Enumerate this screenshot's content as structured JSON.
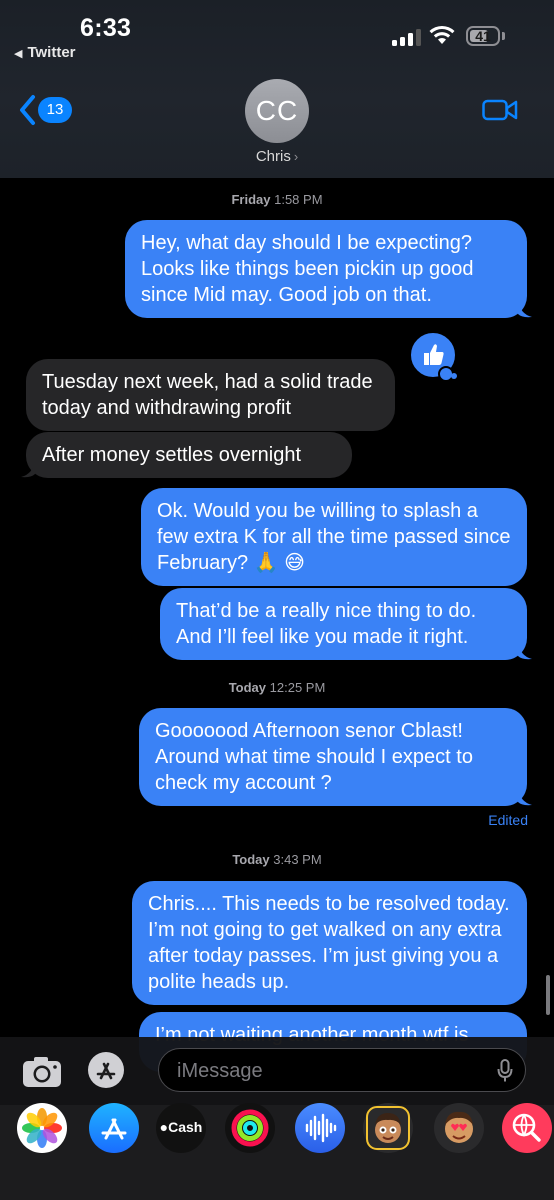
{
  "status_bar": {
    "time": "6:33",
    "back_app": "Twitter",
    "battery": "41"
  },
  "header": {
    "back_badge": "13",
    "avatar_initials": "CC",
    "contact_name": "Chris"
  },
  "messages": {
    "ts1": {
      "day": "Friday",
      "time": "1:58 PM"
    },
    "m1": "Hey, what day should I be expecting? Looks like things been pickin up good since Mid may. Good job on that.",
    "m2": "Tuesday next week, had a solid trade today and withdrawing profit",
    "m3": "After money settles overnight",
    "m4": "Ok. Would you be willing to splash a few extra K for all the time passed since February? 🙏 😅",
    "m5": "That’d be a really nice thing to do. And I’ll feel like you made it right.",
    "ts2": {
      "day": "Today",
      "time": "12:25 PM"
    },
    "m6": "Gooooood Afternoon senor Cblast! Around what time should I expect to check my account ?",
    "edited": "Edited",
    "ts3": {
      "day": "Today",
      "time": "3:43 PM"
    },
    "m7": "Chris.... This needs to be resolved today. I’m not going to get walked on any extra after today passes. I’m just giving you a polite heads up.",
    "m8": "I’m not waiting another month wtf is"
  },
  "input": {
    "placeholder": "iMessage"
  },
  "app_tray": {
    "cash_label": "Cash"
  },
  "colors": {
    "outgoing": "#3a82f6",
    "incoming": "#262628",
    "accent": "#0a84ff"
  }
}
